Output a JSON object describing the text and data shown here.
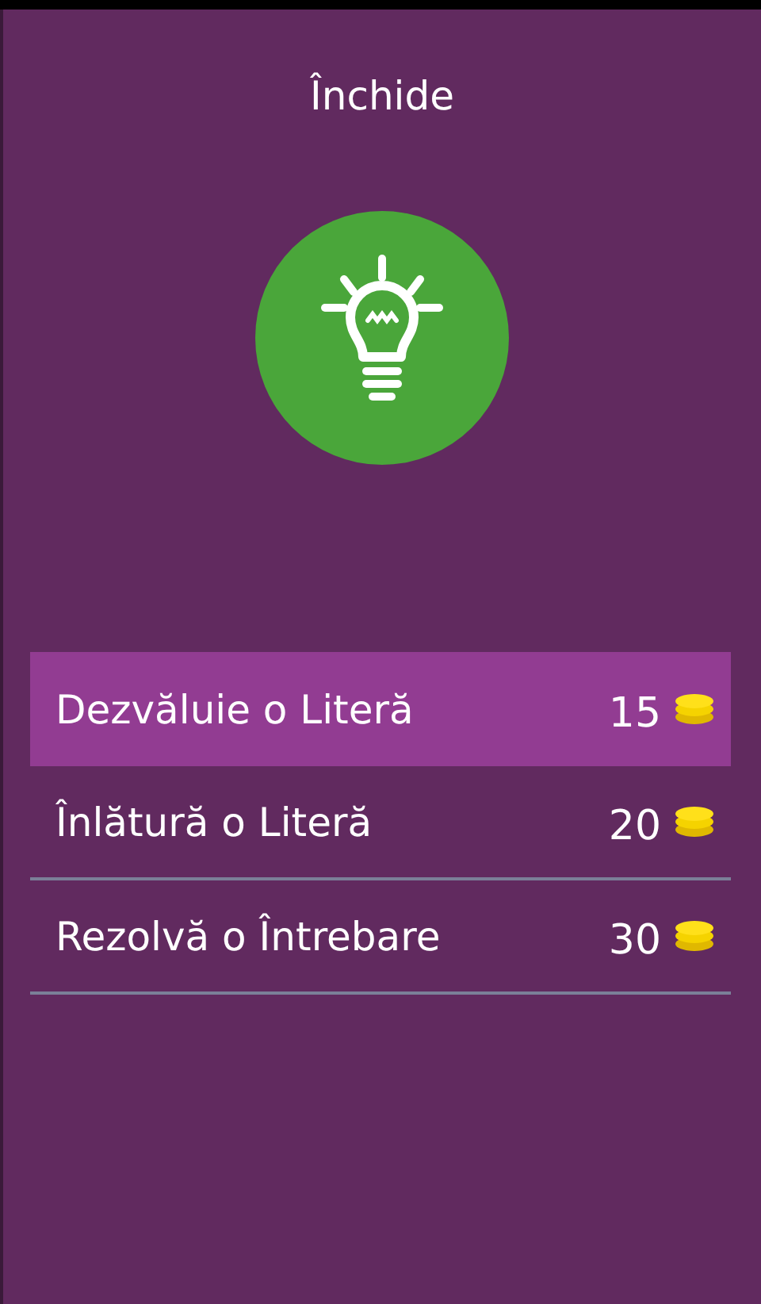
{
  "close_label": "Închide",
  "options": [
    {
      "label": "Dezvăluie o Literă",
      "price": "15",
      "selected": true
    },
    {
      "label": "Înlătură o Literă",
      "price": "20",
      "selected": false
    },
    {
      "label": "Rezolvă o Întrebare",
      "price": "30",
      "selected": false
    }
  ]
}
